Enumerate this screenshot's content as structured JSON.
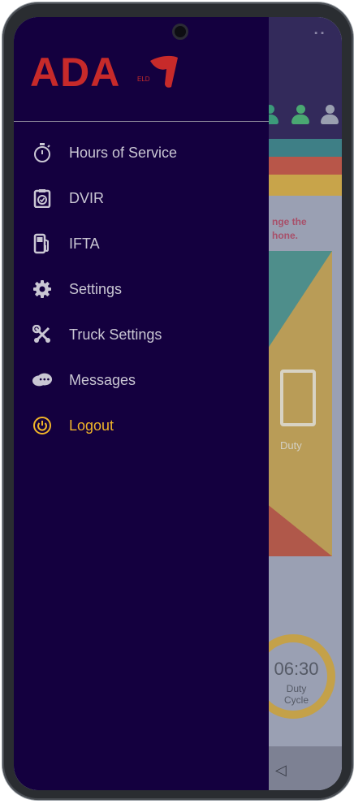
{
  "app": {
    "logo_text": "ADA",
    "logo_sub": "ELD",
    "brand_color": "#c72a2a",
    "drawer_bg": "#14003f"
  },
  "drawer": {
    "items": [
      {
        "label": "Hours of Service",
        "icon": "stopwatch-icon"
      },
      {
        "label": "DVIR",
        "icon": "clipboard-check-icon"
      },
      {
        "label": "IFTA",
        "icon": "fuel-pump-icon"
      },
      {
        "label": "Settings",
        "icon": "gear-icon"
      },
      {
        "label": "Truck Settings",
        "icon": "tools-icon"
      },
      {
        "label": "Messages",
        "icon": "chat-bubbles-icon"
      },
      {
        "label": "Logout",
        "icon": "power-icon",
        "color": "#f0b429"
      }
    ]
  },
  "background": {
    "warning_text": [
      "nge the",
      "hone."
    ],
    "status_label": "Duty",
    "duty_cycle_time": "06:30",
    "duty_cycle_label": [
      "Duty",
      "Cycle"
    ],
    "back_icon": "back-triangle-icon"
  }
}
